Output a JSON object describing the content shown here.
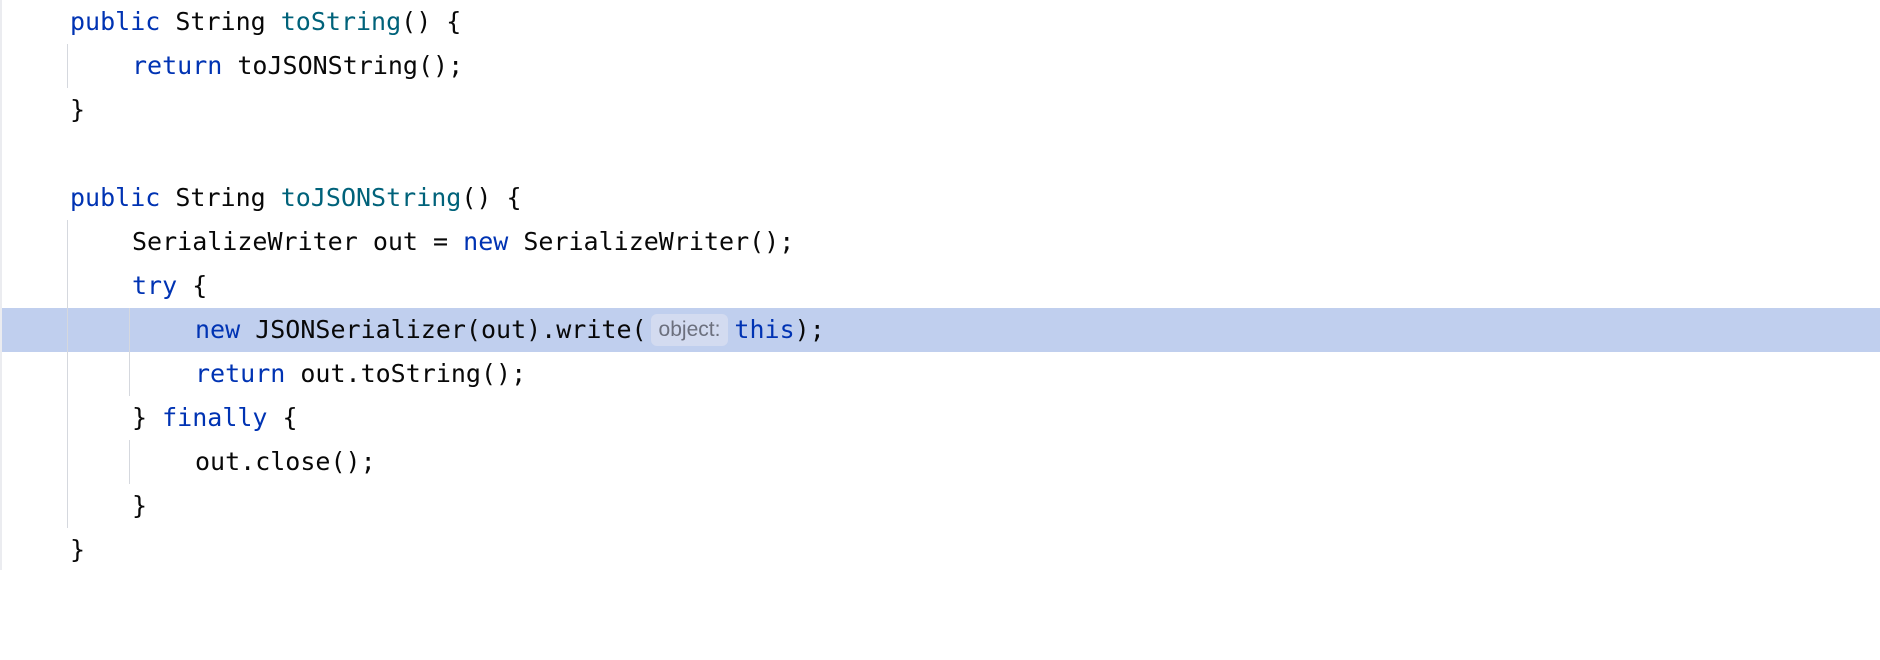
{
  "editor": {
    "lines": [
      {
        "tokens": [
          "public",
          " String ",
          "toString",
          "() {"
        ]
      },
      {
        "tokens": [
          "return",
          " toJSONString();"
        ]
      },
      {
        "tokens": [
          "}"
        ]
      },
      {
        "tokens": []
      },
      {
        "tokens": [
          "public",
          " String ",
          "toJSONString",
          "() {"
        ]
      },
      {
        "tokens": [
          "SerializeWriter out = ",
          "new",
          " SerializeWriter();"
        ]
      },
      {
        "tokens": [
          "try",
          " {"
        ]
      },
      {
        "tokens": [
          "new",
          " JSONSerializer(out).write(",
          "object:",
          "this",
          ");"
        ]
      },
      {
        "tokens": [
          "return",
          " out.toString();"
        ]
      },
      {
        "tokens": [
          "} ",
          "finally",
          " {"
        ]
      },
      {
        "tokens": [
          "out.close();"
        ]
      },
      {
        "tokens": [
          "}"
        ]
      },
      {
        "tokens": [
          "}"
        ]
      }
    ],
    "current_line": 8,
    "colors": {
      "keyword": "#0033b3",
      "method_declaration": "#00627a",
      "text": "#080808",
      "current_line_highlight": "#c0cfee",
      "inlay_hint": "#6c707e"
    }
  }
}
